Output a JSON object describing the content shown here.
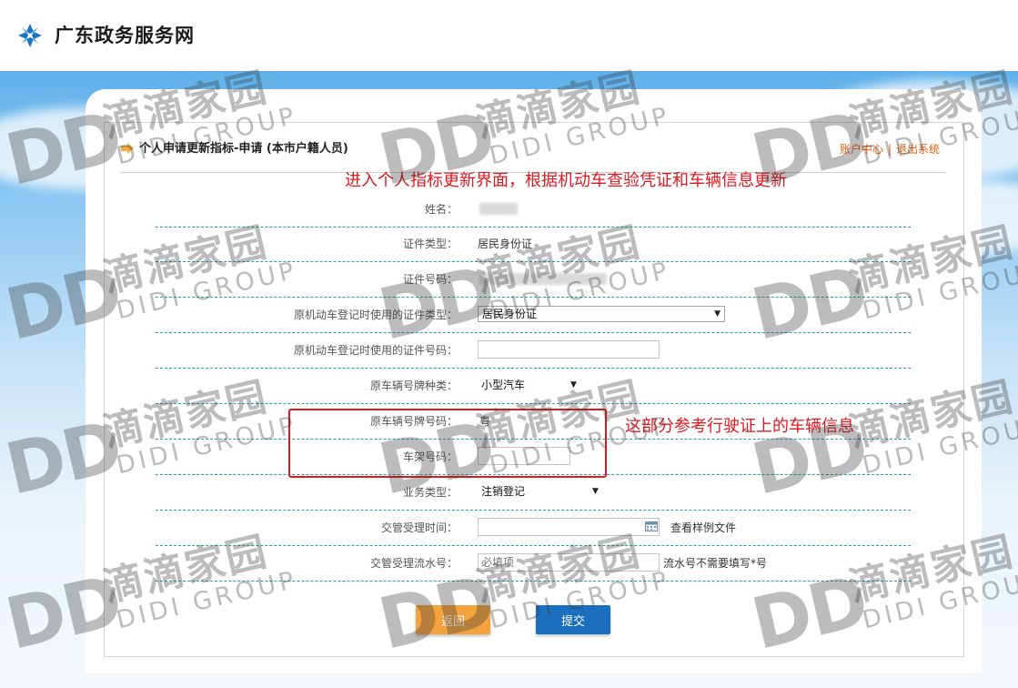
{
  "site": {
    "title": "广东政务服务网"
  },
  "page": {
    "title": "个人申请更新指标-申请 (本市户籍人员)",
    "links": {
      "account": "账户中心",
      "separator": "|",
      "logout": "退出系统"
    }
  },
  "annotations": {
    "top": "进入个人指标更新界面，根据机动车查验凭证和车辆信息更新",
    "side": "这部分参考行驶证上的车辆信息"
  },
  "form": {
    "name_label": "姓名：",
    "id_type_label": "证件类型：",
    "id_type_value": "居民身份证",
    "id_number_label": "证件号码：",
    "orig_id_type_label": "原机动车登记时使用的证件类型：",
    "orig_id_type_value": "居民身份证",
    "orig_id_number_label": "原机动车登记时使用的证件号码：",
    "orig_id_number_value": "",
    "plate_type_label": "原车辆号牌种类：",
    "plate_type_value": "小型汽车",
    "plate_number_label": "原车辆号牌号码：",
    "plate_number_value": "粤",
    "frame_number_label": "车架号码：",
    "frame_number_value": "",
    "business_type_label": "业务类型：",
    "business_type_value": "注销登记",
    "accept_time_label": "交管受理时间：",
    "accept_time_value": "",
    "view_sample_label": "查看样例文件",
    "serial_label": "交管受理流水号：",
    "serial_placeholder": "必填项",
    "serial_hint": "流水号不需要填写*号"
  },
  "buttons": {
    "back": "返回",
    "submit": "提交"
  },
  "watermark": {
    "logo": "DD",
    "cn": "滴滴家园",
    "en": "DIDI GROUP"
  },
  "colors": {
    "accent_orange": "#f4a33c",
    "primary_blue": "#1a6fbe",
    "annotation_red": "#e0181f",
    "link_orange": "#e8600f"
  }
}
